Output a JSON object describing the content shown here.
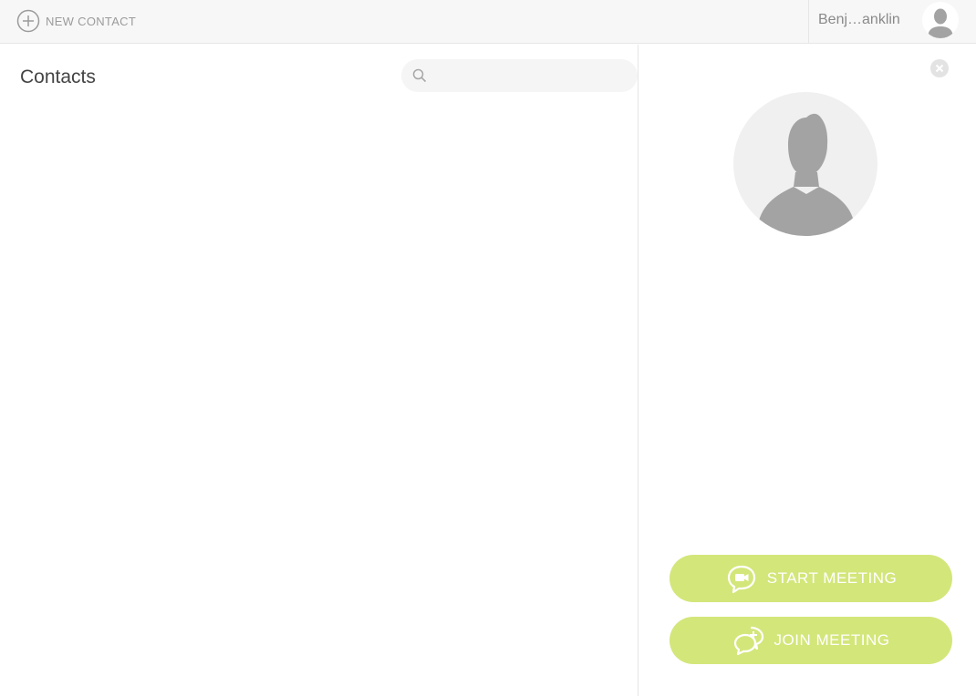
{
  "topbar": {
    "new_contact_label": "NEW CONTACT",
    "username": "Benj…anklin"
  },
  "contacts": {
    "title": "Contacts",
    "search_placeholder": "",
    "search_value": ""
  },
  "detail": {
    "start_meeting_label": "START MEETING",
    "join_meeting_label": "JOIN MEETING"
  },
  "icons": {
    "new_contact": "plus-circle-icon",
    "user_avatar": "user-avatar-icon",
    "search": "search-icon",
    "close": "close-circle-icon",
    "contact_avatar": "person-silhouette-icon",
    "start_meeting": "video-chat-icon",
    "join_meeting": "chat-plus-icon"
  },
  "colors": {
    "accent_green": "#d3e67a",
    "topbar_bg": "#f7f7f7",
    "avatar_gray": "#a3a3a3"
  }
}
